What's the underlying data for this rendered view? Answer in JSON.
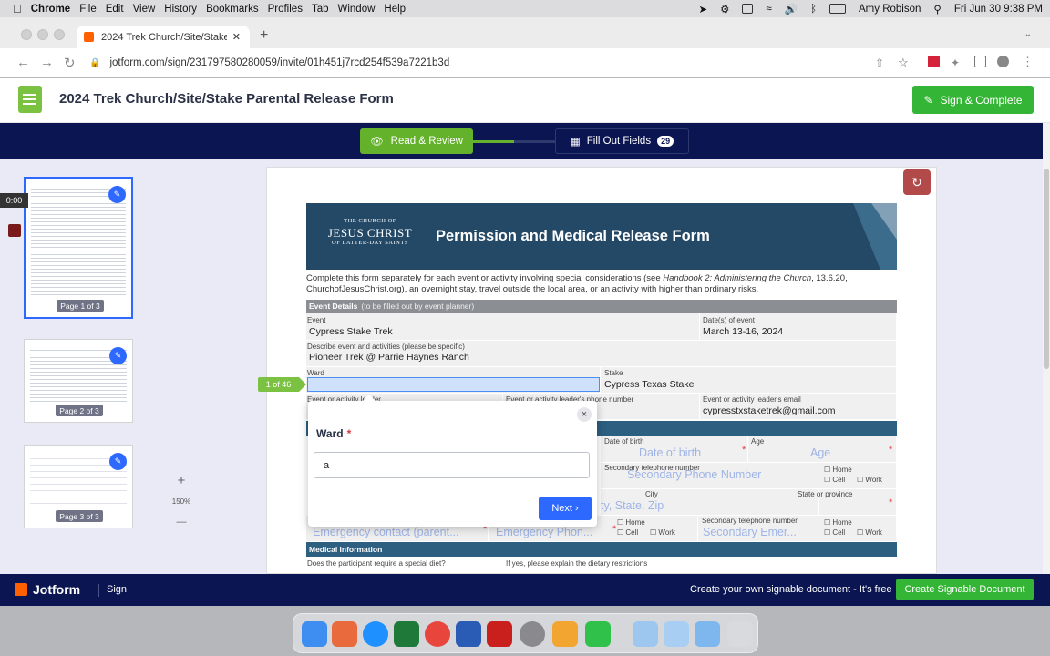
{
  "menubar": {
    "apple": "",
    "items": [
      "Chrome",
      "File",
      "Edit",
      "View",
      "History",
      "Bookmarks",
      "Profiles",
      "Tab",
      "Window",
      "Help"
    ],
    "user": "Amy Robison",
    "clock": "Fri Jun 30  9:38 PM"
  },
  "browser": {
    "tab_title": "2024 Trek Church/Site/Stake P",
    "url": "jotform.com/sign/231797580280059/invite/01h451j7rcd254f539a7221b3d"
  },
  "header": {
    "title": "2024 Trek Church/Site/Stake Parental Release Form",
    "sign_button": "Sign & Complete"
  },
  "steps": {
    "read": "Read & Review",
    "fill": "Fill Out Fields",
    "fill_count": "29"
  },
  "sidebar": {
    "recording_time": "0:00",
    "pages": [
      "Page 1 of 3",
      "Page 2 of 3",
      "Page 3 of 3"
    ],
    "zoom_in": "+",
    "zoom_level": "150%",
    "zoom_out": "—"
  },
  "form": {
    "logo_line1": "THE CHURCH OF",
    "logo_line2": "JESUS CHRIST",
    "logo_line3": "OF LATTER-DAY SAINTS",
    "title": "Permission and Medical Release Form",
    "intro_a": "Complete this form separately for each event or activity involving special considerations (see ",
    "intro_italic": "Handbook 2: Administering the Church",
    "intro_b": ", 13.6.20, ChurchofJesusChrist.org), an overnight stay, travel outside the local area, or an activity with higher than ordinary risks.",
    "event_details": "Event Details",
    "event_details_sub": "(to be filled out by event planner)",
    "event_label": "Event",
    "event_value": "Cypress Stake Trek",
    "dates_label": "Date(s) of event",
    "dates_value": "March 13-16, 2024",
    "describe_label": "Describe event and activities (please be specific)",
    "describe_value": "Pioneer Trek @ Parrie Haynes Ranch",
    "ward_label": "Ward",
    "stake_label": "Stake",
    "stake_value": "Cypress Texas Stake",
    "leader_label": "Event or activity leader",
    "leader_phone_label": "Event or activity leader's phone number",
    "leader_email_label": "Event or activity leader's email",
    "leader_email_value": "cypresstxstaketrek@gmail.com",
    "dob_label": "Date of birth",
    "dob_placeholder": "Date of birth",
    "age_label": "Age",
    "age_placeholder": "Age",
    "second_phone_label": "Secondary telephone number",
    "second_phone_placeholder": "Secondary Phone Number",
    "home": "Home",
    "cell": "Cell",
    "work": "Work",
    "city_label": "City",
    "city_placeholder": "ty, State, Zip",
    "state_label": "State or province",
    "emergency_contact_placeholder": "Emergency contact (parent...",
    "emergency_phone_placeholder": "Emergency Phon...",
    "second_emergency_label": "Secondary telephone number",
    "second_emergency_placeholder": "Secondary Emer...",
    "medical_info": "Medical Information",
    "diet_label": "Does the participant require a special diet?",
    "diet_explain_label": "If yes, please explain the dietary restrictions"
  },
  "field_counter": "1 of 46",
  "popup": {
    "label": "Ward",
    "required_mark": "*",
    "input_value": "a",
    "next": "Next",
    "close": "×"
  },
  "footer": {
    "brand": "Jotform",
    "section": "Sign",
    "promo": "Create your own signable document - It's free",
    "create_button": "Create Signable Document"
  },
  "colors": {
    "jotform_navy": "#0a1551",
    "green": "#35b535",
    "read_green": "#64b22b",
    "blue": "#2e69ff",
    "banner": "#244967"
  }
}
